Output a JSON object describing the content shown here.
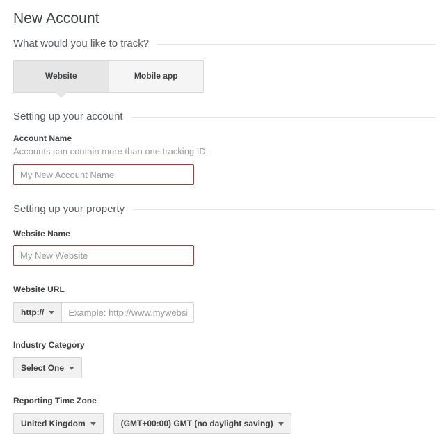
{
  "page": {
    "title": "New Account"
  },
  "track_section": {
    "heading": "What would you like to track?",
    "tabs": [
      {
        "label": "Website",
        "selected": true
      },
      {
        "label": "Mobile app",
        "selected": false
      }
    ]
  },
  "account_section": {
    "heading": "Setting up your account",
    "account_name": {
      "label": "Account Name",
      "help": "Accounts can contain more than one tracking ID.",
      "value": "",
      "placeholder": "My New Account Name"
    }
  },
  "property_section": {
    "heading": "Setting up your property",
    "website_name": {
      "label": "Website Name",
      "value": "",
      "placeholder": "My New Website"
    },
    "website_url": {
      "label": "Website URL",
      "protocol": "http://",
      "value": "",
      "placeholder": "Example: http://www.mywebsite.com"
    },
    "industry_category": {
      "label": "Industry Category",
      "selected": "Select One"
    },
    "reporting_time_zone": {
      "label": "Reporting Time Zone",
      "country": "United Kingdom",
      "zone": "(GMT+00:00) GMT (no daylight saving)"
    }
  },
  "icons": {
    "caret_down": "chevron-down-icon"
  },
  "colors": {
    "error_border": "#b8372a",
    "tab_selected_bg": "#e6e6e6",
    "tab_bg": "#f5f5f5",
    "rule": "#e3e3e3",
    "text": "#3c4043",
    "muted_text": "#9e9e9e"
  }
}
